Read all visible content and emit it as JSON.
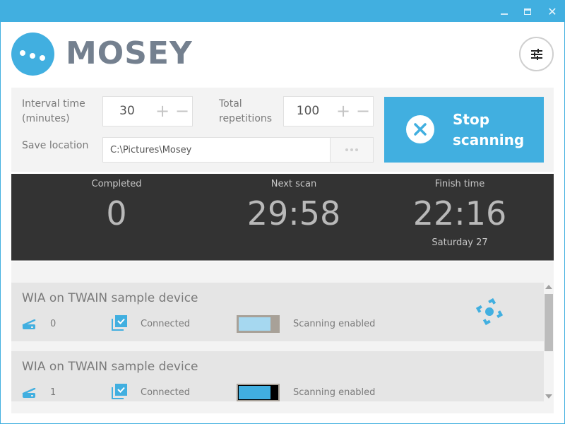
{
  "window": {
    "title": "MOSEY",
    "controls": {
      "minimize": "minimize",
      "maximize": "maximize",
      "close": "close"
    }
  },
  "header": {
    "app_name": "MOSEY",
    "logo_icon": "three-dots-circle-icon",
    "settings_icon": "sliders-icon"
  },
  "config": {
    "interval_label": "Interval time\n(minutes)",
    "interval_label_line1": "Interval time",
    "interval_label_line2": "(minutes)",
    "interval_value": "30",
    "total_label_line1": "Total",
    "total_label_line2": "repetitions",
    "total_value": "100",
    "plus": "+",
    "minus": "−",
    "save_label": "Save location",
    "save_path": "C:\\Pictures\\Mosey",
    "browse_icon": "ellipsis-icon",
    "stop_button_line1": "Stop",
    "stop_button_line2": "scanning"
  },
  "stats": [
    {
      "caption": "Completed",
      "value": "0",
      "sub": ""
    },
    {
      "caption": "Next scan",
      "value": "29:58",
      "sub": ""
    },
    {
      "caption": "Finish time",
      "value": "22:16",
      "sub": "Saturday 27"
    }
  ],
  "devices": [
    {
      "name": "WIA on TWAIN sample device",
      "index": "0",
      "status": "Connected",
      "toggle_label": "Scanning enabled",
      "toggle_on": true,
      "toggle_hover": false,
      "show_locate": true
    },
    {
      "name": "WIA on TWAIN sample device",
      "index": "1",
      "status": "Connected",
      "toggle_label": "Scanning enabled",
      "toggle_on": true,
      "toggle_hover": true,
      "show_locate": false
    }
  ],
  "colors": {
    "accent": "#41afe0",
    "stats_bg": "#333333",
    "title_text": "#74808f"
  }
}
